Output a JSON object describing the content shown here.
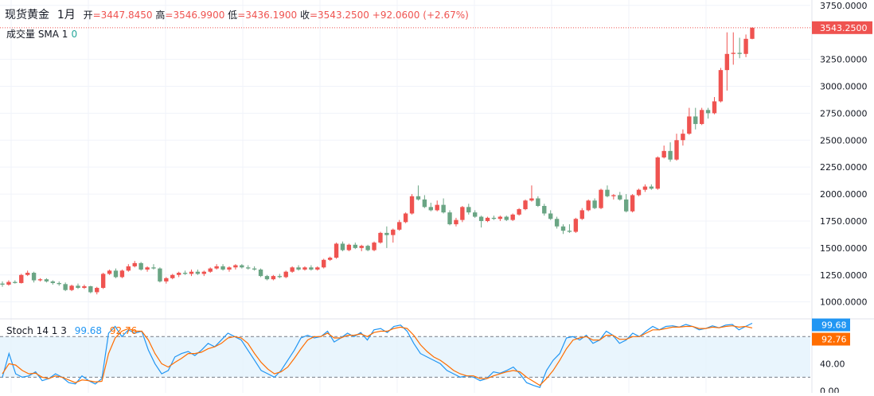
{
  "header": {
    "symbol": "现货黄金",
    "interval": "1月",
    "open_label": "开",
    "open": "=3447.8450",
    "high_label": "高",
    "high": "=3546.9900",
    "low_label": "低",
    "low": "=3436.1900",
    "close_label": "收",
    "close": "=3543.2500",
    "change": "+92.0600 (+2.67%)"
  },
  "volume": {
    "label": "成交量 SMA 1",
    "value": "0"
  },
  "stoch": {
    "label": "Stoch 14 1 3",
    "k_value": "99.68",
    "d_value": "92.76"
  },
  "price_badge": "3543.2500",
  "colors": {
    "up": "#ef5350",
    "down": "#6aa584",
    "k_line": "#2196f3",
    "d_line": "#ff6d00",
    "band": "#e3f2fd"
  },
  "chart_data": [
    {
      "type": "candlestick",
      "ylim": [
        850,
        3800
      ],
      "y_ticks": [
        "1000.0000",
        "1250.0000",
        "1500.0000",
        "1750.0000",
        "2000.0000",
        "2250.0000",
        "2500.0000",
        "2750.0000",
        "3000.0000",
        "3250.0000",
        "3750.0000"
      ],
      "last_price": 3543.25,
      "candles": [
        [
          1170,
          1190,
          1140,
          1160
        ],
        [
          1160,
          1200,
          1150,
          1185
        ],
        [
          1185,
          1200,
          1170,
          1175
        ],
        [
          1175,
          1260,
          1170,
          1250
        ],
        [
          1250,
          1290,
          1240,
          1270
        ],
        [
          1270,
          1280,
          1180,
          1200
        ],
        [
          1200,
          1220,
          1190,
          1210
        ],
        [
          1210,
          1220,
          1180,
          1190
        ],
        [
          1190,
          1200,
          1160,
          1175
        ],
        [
          1175,
          1190,
          1150,
          1165
        ],
        [
          1165,
          1180,
          1100,
          1110
        ],
        [
          1110,
          1160,
          1100,
          1150
        ],
        [
          1150,
          1170,
          1120,
          1130
        ],
        [
          1130,
          1160,
          1120,
          1145
        ],
        [
          1145,
          1150,
          1080,
          1090
        ],
        [
          1090,
          1140,
          1070,
          1130
        ],
        [
          1130,
          1270,
          1120,
          1260
        ],
        [
          1260,
          1300,
          1250,
          1290
        ],
        [
          1290,
          1310,
          1220,
          1230
        ],
        [
          1230,
          1300,
          1220,
          1290
        ],
        [
          1290,
          1350,
          1280,
          1330
        ],
        [
          1330,
          1380,
          1320,
          1360
        ],
        [
          1360,
          1370,
          1290,
          1300
        ],
        [
          1300,
          1330,
          1280,
          1320
        ],
        [
          1320,
          1350,
          1300,
          1310
        ],
        [
          1310,
          1320,
          1180,
          1190
        ],
        [
          1190,
          1230,
          1170,
          1220
        ],
        [
          1220,
          1260,
          1210,
          1250
        ],
        [
          1250,
          1280,
          1230,
          1270
        ],
        [
          1270,
          1290,
          1250,
          1260
        ],
        [
          1260,
          1300,
          1240,
          1280
        ],
        [
          1280,
          1300,
          1250,
          1260
        ],
        [
          1260,
          1290,
          1240,
          1280
        ],
        [
          1280,
          1320,
          1270,
          1310
        ],
        [
          1310,
          1350,
          1300,
          1330
        ],
        [
          1330,
          1350,
          1290,
          1300
        ],
        [
          1300,
          1330,
          1280,
          1320
        ],
        [
          1320,
          1350,
          1300,
          1340
        ],
        [
          1340,
          1350,
          1310,
          1320
        ],
        [
          1320,
          1340,
          1300,
          1310
        ],
        [
          1310,
          1330,
          1290,
          1300
        ],
        [
          1300,
          1310,
          1230,
          1240
        ],
        [
          1240,
          1250,
          1200,
          1210
        ],
        [
          1210,
          1250,
          1200,
          1240
        ],
        [
          1240,
          1260,
          1220,
          1230
        ],
        [
          1230,
          1290,
          1220,
          1280
        ],
        [
          1280,
          1330,
          1270,
          1320
        ],
        [
          1320,
          1340,
          1290,
          1300
        ],
        [
          1300,
          1330,
          1290,
          1320
        ],
        [
          1320,
          1340,
          1290,
          1300
        ],
        [
          1300,
          1330,
          1290,
          1320
        ],
        [
          1320,
          1400,
          1310,
          1390
        ],
        [
          1390,
          1420,
          1380,
          1410
        ],
        [
          1410,
          1550,
          1400,
          1540
        ],
        [
          1540,
          1560,
          1470,
          1480
        ],
        [
          1480,
          1540,
          1470,
          1530
        ],
        [
          1530,
          1550,
          1490,
          1500
        ],
        [
          1500,
          1530,
          1470,
          1520
        ],
        [
          1520,
          1530,
          1470,
          1480
        ],
        [
          1480,
          1560,
          1470,
          1550
        ],
        [
          1550,
          1650,
          1540,
          1640
        ],
        [
          1640,
          1700,
          1500,
          1620
        ],
        [
          1620,
          1680,
          1550,
          1670
        ],
        [
          1670,
          1760,
          1660,
          1740
        ],
        [
          1740,
          1830,
          1730,
          1820
        ],
        [
          1820,
          2000,
          1810,
          1980
        ],
        [
          1980,
          2080,
          1940,
          1950
        ],
        [
          1950,
          1990,
          1870,
          1880
        ],
        [
          1880,
          1920,
          1840,
          1850
        ],
        [
          1850,
          1940,
          1840,
          1900
        ],
        [
          1900,
          1960,
          1820,
          1830
        ],
        [
          1830,
          1850,
          1710,
          1720
        ],
        [
          1720,
          1780,
          1700,
          1760
        ],
        [
          1760,
          1890,
          1740,
          1880
        ],
        [
          1880,
          1910,
          1810,
          1830
        ],
        [
          1830,
          1850,
          1780,
          1790
        ],
        [
          1790,
          1800,
          1690,
          1750
        ],
        [
          1750,
          1790,
          1740,
          1780
        ],
        [
          1780,
          1800,
          1760,
          1770
        ],
        [
          1770,
          1800,
          1750,
          1790
        ],
        [
          1790,
          1800,
          1750,
          1760
        ],
        [
          1760,
          1820,
          1750,
          1810
        ],
        [
          1810,
          1870,
          1800,
          1860
        ],
        [
          1860,
          1950,
          1850,
          1940
        ],
        [
          1940,
          2080,
          1930,
          1960
        ],
        [
          1960,
          1980,
          1880,
          1890
        ],
        [
          1890,
          1910,
          1800,
          1820
        ],
        [
          1820,
          1850,
          1760,
          1770
        ],
        [
          1770,
          1790,
          1680,
          1700
        ],
        [
          1700,
          1720,
          1630,
          1660
        ],
        [
          1660,
          1720,
          1640,
          1650
        ],
        [
          1650,
          1780,
          1640,
          1770
        ],
        [
          1770,
          1870,
          1760,
          1850
        ],
        [
          1850,
          1950,
          1840,
          1940
        ],
        [
          1940,
          1960,
          1860,
          1870
        ],
        [
          1870,
          2050,
          1860,
          2040
        ],
        [
          2040,
          2080,
          1970,
          1980
        ],
        [
          1980,
          2000,
          1950,
          1990
        ],
        [
          1990,
          2020,
          1940,
          1950
        ],
        [
          1950,
          2000,
          1830,
          1840
        ],
        [
          1840,
          2000,
          1830,
          1990
        ],
        [
          1990,
          2050,
          1980,
          2040
        ],
        [
          2040,
          2090,
          2020,
          2070
        ],
        [
          2070,
          2090,
          2040,
          2050
        ],
        [
          2050,
          2350,
          2040,
          2340
        ],
        [
          2340,
          2450,
          2330,
          2400
        ],
        [
          2400,
          2480,
          2300,
          2320
        ],
        [
          2320,
          2560,
          2310,
          2500
        ],
        [
          2500,
          2600,
          2450,
          2560
        ],
        [
          2560,
          2800,
          2550,
          2720
        ],
        [
          2720,
          2800,
          2600,
          2650
        ],
        [
          2650,
          2800,
          2640,
          2780
        ],
        [
          2780,
          2800,
          2700,
          2750
        ],
        [
          2750,
          2900,
          2740,
          2860
        ],
        [
          2860,
          3170,
          2850,
          3150
        ],
        [
          3150,
          3500,
          2960,
          3300
        ],
        [
          3300,
          3500,
          3200,
          3310
        ],
        [
          3310,
          3450,
          3260,
          3300
        ],
        [
          3300,
          3480,
          3270,
          3440
        ],
        [
          3440,
          3547,
          3436,
          3543
        ]
      ]
    },
    {
      "type": "line",
      "ylim": [
        0,
        100
      ],
      "y_ticks": [
        "0.00",
        "40.00"
      ],
      "band": [
        20,
        80
      ],
      "series": [
        {
          "name": "K",
          "values": [
            20,
            55,
            25,
            20,
            22,
            28,
            15,
            18,
            25,
            20,
            12,
            10,
            22,
            15,
            10,
            18,
            85,
            95,
            80,
            90,
            85,
            88,
            60,
            40,
            25,
            30,
            50,
            55,
            58,
            52,
            60,
            70,
            65,
            75,
            85,
            80,
            75,
            60,
            45,
            30,
            25,
            20,
            30,
            45,
            60,
            78,
            82,
            78,
            80,
            88,
            72,
            78,
            85,
            80,
            86,
            75,
            90,
            92,
            86,
            95,
            97,
            88,
            70,
            55,
            50,
            45,
            40,
            30,
            25,
            20,
            22,
            20,
            15,
            18,
            28,
            26,
            30,
            35,
            25,
            12,
            8,
            5,
            30,
            45,
            55,
            78,
            80,
            75,
            82,
            70,
            75,
            88,
            82,
            70,
            75,
            85,
            80,
            88,
            95,
            90,
            95,
            96,
            94,
            98,
            95,
            90,
            92,
            96,
            93,
            97,
            98,
            90,
            95,
            99.68
          ]
        },
        {
          "name": "D",
          "values": [
            25,
            40,
            38,
            30,
            25,
            26,
            20,
            18,
            22,
            20,
            16,
            12,
            16,
            15,
            13,
            14,
            55,
            78,
            88,
            92,
            88,
            88,
            75,
            55,
            40,
            35,
            42,
            48,
            55,
            55,
            57,
            62,
            65,
            70,
            78,
            80,
            78,
            70,
            55,
            42,
            32,
            25,
            28,
            35,
            48,
            62,
            75,
            80,
            80,
            85,
            78,
            78,
            82,
            82,
            84,
            80,
            86,
            88,
            88,
            92,
            94,
            92,
            82,
            68,
            58,
            50,
            45,
            38,
            30,
            25,
            22,
            22,
            18,
            18,
            22,
            25,
            28,
            30,
            28,
            20,
            14,
            8,
            18,
            30,
            45,
            62,
            75,
            78,
            80,
            75,
            75,
            82,
            82,
            76,
            76,
            80,
            80,
            85,
            90,
            90,
            92,
            94,
            94,
            95,
            95,
            92,
            92,
            94,
            93,
            95,
            96,
            94,
            95,
            92.76
          ]
        }
      ]
    }
  ]
}
